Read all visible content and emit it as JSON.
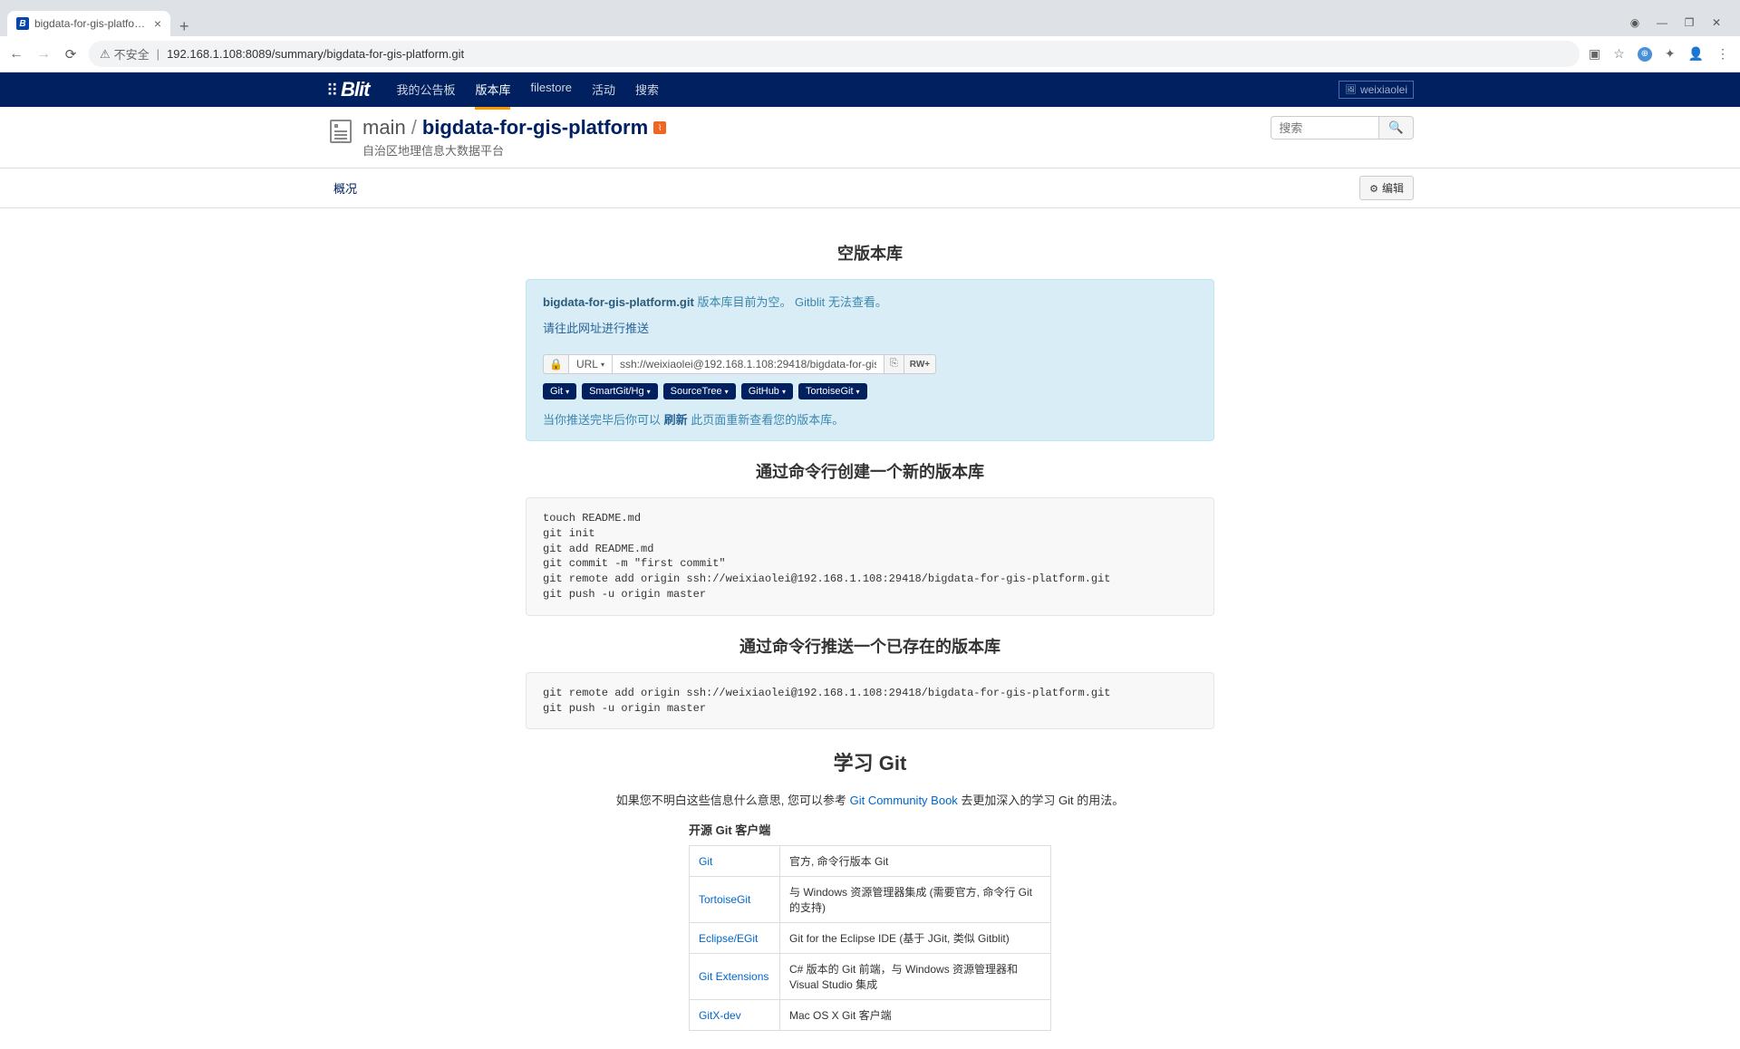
{
  "browser": {
    "tab_title": "bigdata-for-gis-platform.git - ",
    "url_prefix": "不安全",
    "url": "192.168.1.108:8089/summary/bigdata-for-gis-platform.git"
  },
  "navbar": {
    "items": [
      "我的公告板",
      "版本库",
      "filestore",
      "活动",
      "搜索"
    ],
    "active_index": 1,
    "user": "weixiaolei"
  },
  "repo": {
    "main": "main",
    "name": "bigdata-for-gis-platform",
    "description": "自治区地理信息大数据平台",
    "search_placeholder": "搜索"
  },
  "subnav": {
    "overview": "概况",
    "edit": "编辑"
  },
  "empty": {
    "heading": "空版本库",
    "repo_name": "bigdata-for-gis-platform.git",
    "msg1": " 版本库目前为空。 Gitblit 无法查看。",
    "push_link": "请往此网址进行推送",
    "url_label": "URL",
    "ssh_url": "ssh://weixiaolei@192.168.1.108:29418/bigdata-for-gis-platform.git",
    "rw_badge": "RW+",
    "tools": [
      "Git",
      "SmartGit/Hg",
      "SourceTree",
      "GitHub",
      "TortoiseGit"
    ],
    "footer_prefix": "当你推送完毕后你可以 ",
    "footer_link": "刷新",
    "footer_suffix": " 此页面重新查看您的版本库。"
  },
  "create": {
    "heading": "通过命令行创建一个新的版本库",
    "code": "touch README.md\ngit init\ngit add README.md\ngit commit -m \"first commit\"\ngit remote add origin ssh://weixiaolei@192.168.1.108:29418/bigdata-for-gis-platform.git\ngit push -u origin master"
  },
  "push": {
    "heading": "通过命令行推送一个已存在的版本库",
    "code": "git remote add origin ssh://weixiaolei@192.168.1.108:29418/bigdata-for-gis-platform.git\ngit push -u origin master"
  },
  "learn": {
    "heading": "学习 Git",
    "intro_prefix": "如果您不明白这些信息什么意思, 您可以参考 ",
    "intro_link": "Git Community Book",
    "intro_suffix": " 去更加深入的学习 Git 的用法。",
    "clients_heading": "开源 Git 客户端",
    "clients": [
      {
        "name": "Git",
        "desc": "官方, 命令行版本 Git"
      },
      {
        "name": "TortoiseGit",
        "desc": "与 Windows 资源管理器集成 (需要官方, 命令行 Git 的支持)"
      },
      {
        "name": "Eclipse/EGit",
        "desc": "Git for the Eclipse IDE (基于 JGit, 类似 Gitblit)"
      },
      {
        "name": "Git Extensions",
        "desc": "C# 版本的 Git 前端，与 Windows 资源管理器和 Visual Studio 集成"
      },
      {
        "name": "GitX-dev",
        "desc": "Mac OS X Git 客户端"
      }
    ]
  }
}
